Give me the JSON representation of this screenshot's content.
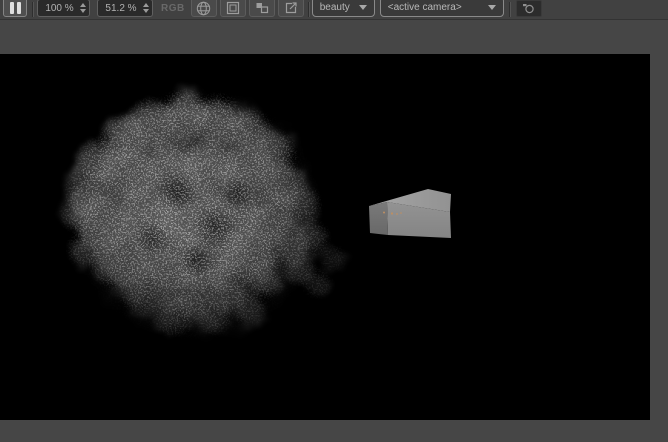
{
  "toolbar": {
    "pause_label": "pause",
    "progress_field": {
      "value": "100 %"
    },
    "zoom_field": {
      "value": "51.2 %"
    },
    "channel_label": "RGB",
    "icon_buttons": {
      "sphere": "globe-wireframe",
      "frame": "single-image",
      "compare": "compare-images",
      "export": "export-image"
    },
    "pass_dropdown": {
      "value": "beauty"
    },
    "camera_dropdown": {
      "value": "<active camera>"
    },
    "snapshot_button": "camera-snapshot"
  },
  "viewport": {
    "canvas_bg": "#000000",
    "frame_bg": "#464646",
    "objects": [
      {
        "name": "smoke-cloud",
        "type": "volumetric-smoke",
        "approx_color": "#8a8a8a"
      },
      {
        "name": "rectangular-box",
        "type": "mesh-box",
        "top_color": "#a0a0a0",
        "front_color": "#8d8d8d",
        "side_color": "#717171",
        "marker_color": "#bd8f62"
      }
    ]
  }
}
